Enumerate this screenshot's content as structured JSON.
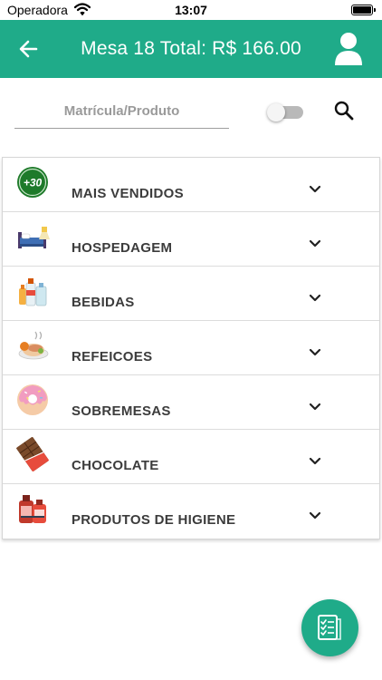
{
  "status_bar": {
    "carrier": "Operadora",
    "time": "13:07"
  },
  "header": {
    "title": "Mesa 18 Total: R$ 166.00",
    "back_icon": "arrow-left-icon",
    "user_icon": "user-icon",
    "background_color": "#1fab89"
  },
  "search": {
    "placeholder": "Matrícula/Produto",
    "value": "",
    "toggle_on": false,
    "search_icon": "magnifier-icon"
  },
  "categories": [
    {
      "label": "MAIS VENDIDOS",
      "icon": "plus-30-badge-icon"
    },
    {
      "label": "HOSPEDAGEM",
      "icon": "bed-icon"
    },
    {
      "label": "BEBIDAS",
      "icon": "bottles-icon"
    },
    {
      "label": "REFEICOES",
      "icon": "meal-icon"
    },
    {
      "label": "SOBREMESAS",
      "icon": "donut-icon"
    },
    {
      "label": "CHOCOLATE",
      "icon": "chocolate-bar-icon"
    },
    {
      "label": "PRODUTOS DE HIGIENE",
      "icon": "hygiene-products-icon"
    }
  ],
  "fab": {
    "icon": "checklist-icon"
  }
}
